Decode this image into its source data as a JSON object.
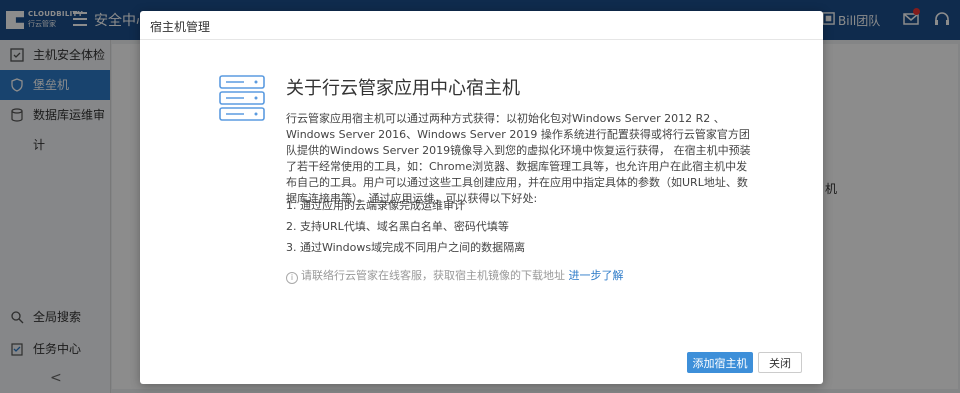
{
  "topbar": {
    "logo_text": "CLOUDBILITY",
    "logo_sub": "行云管家",
    "app_title": "安全中心",
    "team_label": "Bill团队"
  },
  "sidebar": {
    "items": [
      {
        "label": "主机安全体检",
        "icon": "shield-check-icon"
      },
      {
        "label": "堡垒机",
        "icon": "shield-icon",
        "active": true
      },
      {
        "label": "数据库运维审计",
        "icon": "database-icon"
      },
      {
        "label": "全局搜索",
        "icon": "search-icon"
      },
      {
        "label": "任务中心",
        "icon": "task-icon"
      }
    ],
    "collapse_glyph": "<"
  },
  "background": {
    "partial_text": "机"
  },
  "modal": {
    "title": "宿主机管理",
    "heading": "关于行云管家应用中心宿主机",
    "description": "行云管家应用宿主机可以通过两种方式获得：以初始化包对Windows Server 2012 R2 、Windows Server 2016、Windows Server 2019 操作系统进行配置获得或将行云管家官方团队提供的Windows Server 2019镜像导入到您的虚拟化环境中恢复运行获得， 在宿主机中预装了若干经常使用的工具，如：Chrome浏览器、数据库管理工具等，也允许用户在此宿主机中发布自己的工具。用户可以通过这些工具创建应用，并在应用中指定具体的参数（如URL地址、数据库连接串等）。通过应用运维，可以获得以下好处:",
    "features": [
      "1. 通过应用的云端录像完成运维审计",
      "2. 支持URL代填、域名黑白名单、密码代填等",
      "3. 通过Windows域完成不同用户之间的数据隔离"
    ],
    "note_text": "请联络行云管家在线客服，获取宿主机镜像的下载地址",
    "note_link": "进一步了解",
    "add_button": "添加宿主机",
    "close_button": "关闭"
  },
  "colors": {
    "brand": "#1c4f8c",
    "accent": "#3d8fd9",
    "sidebar_active": "#2d7bc8"
  }
}
